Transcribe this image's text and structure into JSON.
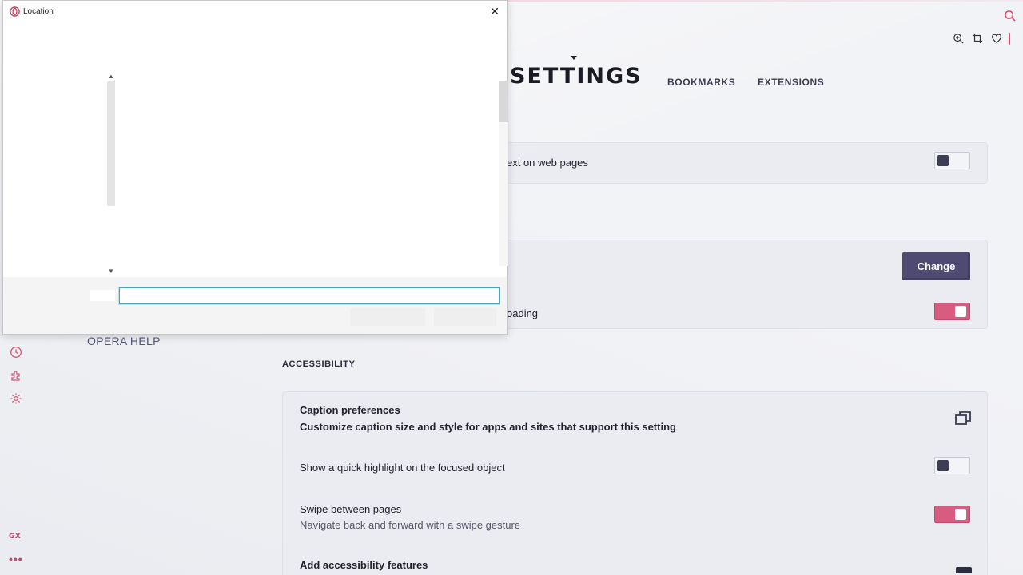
{
  "dialog": {
    "title": "Location",
    "close_label": "✕",
    "folder_value": "",
    "folder_label": "",
    "ok_label": "",
    "cancel_label": ""
  },
  "header": {
    "title": "SETTINGS",
    "nav": [
      "BOOKMARKS",
      "EXTENSIONS"
    ]
  },
  "settings": {
    "highlight_text_row": "ext on web pages",
    "change_button": "Change",
    "downloading_row": "oading",
    "accessibility_label": "ACCESSIBILITY",
    "opera_help": "OPERA HELP",
    "rows": [
      {
        "title": "Caption preferences",
        "subtitle": "Customize caption size and style for apps and sites that support this setting"
      },
      {
        "title": "Show a quick highlight on the focused object"
      },
      {
        "title": "Swipe between pages",
        "subtitle": "Navigate back and forward with a swipe gesture"
      },
      {
        "title": "Add accessibility features"
      }
    ]
  },
  "sidebar": {
    "gx_label": "GX",
    "more_label": "•••"
  },
  "colors": {
    "accent": "#d85c80",
    "button": "#4e4a72",
    "knob": "#3e3d56"
  }
}
